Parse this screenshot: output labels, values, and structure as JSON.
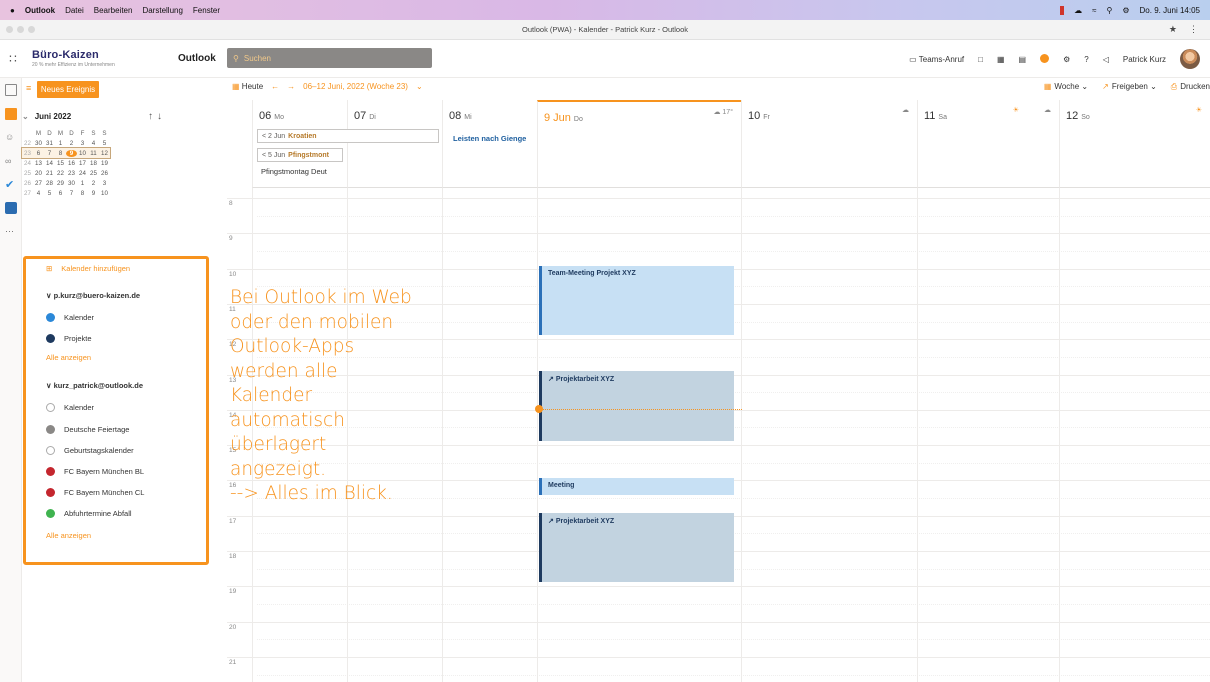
{
  "menubar": {
    "apple": "",
    "items": [
      "Outlook",
      "Datei",
      "Bearbeiten",
      "Darstellung",
      "Fenster"
    ],
    "datetime": "Do. 9. Juni  14:05"
  },
  "window": {
    "title": "Outlook (PWA) - Kalender - Patrick Kurz - Outlook"
  },
  "header": {
    "brand": "Büro-Kaizen",
    "brand_sub": "20 % mehr Effizienz im Unternehmen",
    "app_name": "Outlook",
    "search_placeholder": "Suchen",
    "teams_call": "Teams-Anruf",
    "user_name": "Patrick Kurz",
    "notification_count": "1"
  },
  "commandbar": {
    "new_event": "Neues Ereignis",
    "today": "Heute",
    "range": "06–12 Juni, 2022 (Woche 23)",
    "view": "Woche",
    "share": "Freigeben",
    "print": "Drucken"
  },
  "minical": {
    "month": "Juni 2022",
    "weekday_headers": [
      "M",
      "D",
      "M",
      "D",
      "F",
      "S",
      "S"
    ],
    "weeks": [
      {
        "wk": "22",
        "days": [
          "30",
          "31",
          "1",
          "2",
          "3",
          "4",
          "5"
        ]
      },
      {
        "wk": "23",
        "days": [
          "6",
          "7",
          "8",
          "9",
          "10",
          "11",
          "12"
        ]
      },
      {
        "wk": "24",
        "days": [
          "13",
          "14",
          "15",
          "16",
          "17",
          "18",
          "19"
        ]
      },
      {
        "wk": "25",
        "days": [
          "20",
          "21",
          "22",
          "23",
          "24",
          "25",
          "26"
        ]
      },
      {
        "wk": "26",
        "days": [
          "27",
          "28",
          "29",
          "30",
          "1",
          "2",
          "3"
        ]
      },
      {
        "wk": "27",
        "days": [
          "4",
          "5",
          "6",
          "7",
          "8",
          "9",
          "10"
        ]
      }
    ],
    "selected_day": "9"
  },
  "calendars": {
    "add": "Kalender hinzufügen",
    "account1": "p.kurz@buero-kaizen.de",
    "account1_items": [
      {
        "label": "Kalender",
        "color": "#2b88d8"
      },
      {
        "label": "Projekte",
        "color": "#1e3a5f"
      }
    ],
    "show_all": "Alle anzeigen",
    "account2": "kurz_patrick@outlook.de",
    "account2_items": [
      {
        "label": "Kalender",
        "color": ""
      },
      {
        "label": "Deutsche Feiertage",
        "color": "#8a8886"
      },
      {
        "label": "Geburtstagskalender",
        "color": ""
      },
      {
        "label": "FC Bayern München BL",
        "color": "#c4262e"
      },
      {
        "label": "FC Bayern München CL",
        "color": "#c4262e"
      },
      {
        "label": "Abfuhrtermine Abfall",
        "color": "#3fb34f"
      }
    ],
    "show_all2": "Alle anzeigen"
  },
  "week": {
    "days": [
      {
        "num": "06",
        "dow": "Mo",
        "weather": ""
      },
      {
        "num": "07",
        "dow": "Di",
        "weather": ""
      },
      {
        "num": "08",
        "dow": "Mi",
        "weather": ""
      },
      {
        "num": "9 Jun",
        "dow": "Do",
        "weather": "17°"
      },
      {
        "num": "10",
        "dow": "Fr",
        "weather": ""
      },
      {
        "num": "11",
        "dow": "Sa",
        "weather": ""
      },
      {
        "num": "12",
        "dow": "So",
        "weather": ""
      }
    ],
    "allday": {
      "kroatien_date": "2 Jun",
      "kroatien": "Kroatien",
      "pfingst_date": "5 Jun",
      "pfingst": "Pfingstmont",
      "pfingstmontag": "Pfingstmontag Deut",
      "leisten": "Leisten nach Gienge"
    },
    "hours": [
      "8",
      "9",
      "10",
      "11",
      "12",
      "13",
      "14",
      "15",
      "16",
      "17",
      "18",
      "19",
      "20",
      "21"
    ],
    "events": [
      {
        "title": "Team-Meeting Projekt XYZ"
      },
      {
        "title": "Projektarbeit XYZ"
      },
      {
        "title": "Meeting"
      },
      {
        "title": "Projektarbeit XYZ"
      }
    ]
  },
  "annotation": {
    "lines": [
      "Bei Outlook im Web",
      "oder den mobilen",
      "Outlook-Apps",
      "werden alle",
      "Kalender",
      "automatisch",
      "überlagert",
      "angezeigt.",
      "--> Alles im Blick."
    ]
  }
}
